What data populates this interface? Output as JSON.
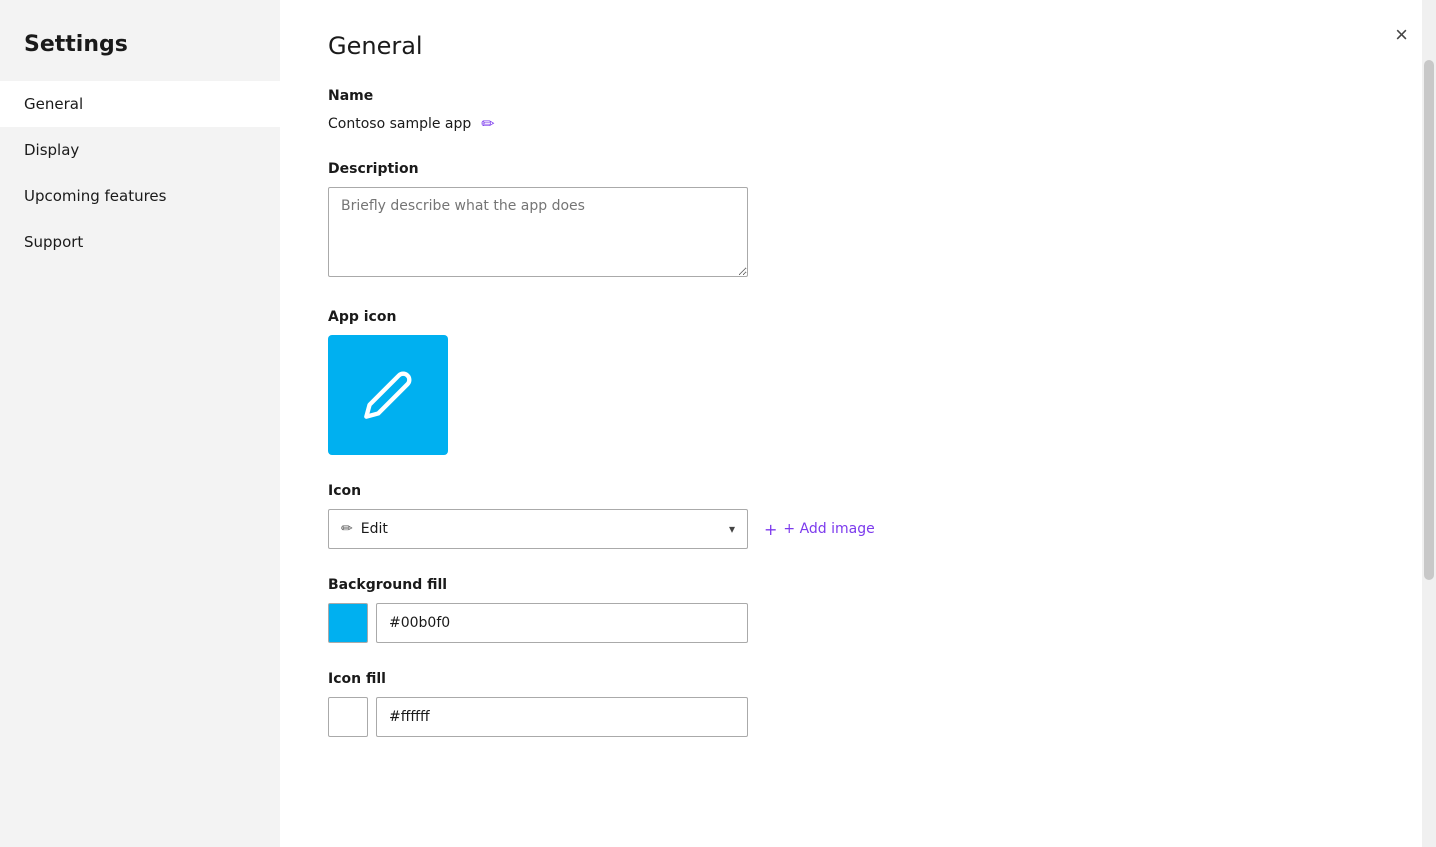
{
  "sidebar": {
    "title": "Settings",
    "items": [
      {
        "id": "general",
        "label": "General",
        "active": true
      },
      {
        "id": "display",
        "label": "Display",
        "active": false
      },
      {
        "id": "upcoming",
        "label": "Upcoming features",
        "active": false
      },
      {
        "id": "support",
        "label": "Support",
        "active": false
      }
    ]
  },
  "main": {
    "page_title": "General",
    "close_label": "×",
    "sections": {
      "name": {
        "label": "Name",
        "value": "Contoso sample app",
        "edit_icon": "✏"
      },
      "description": {
        "label": "Description",
        "placeholder": "Briefly describe what the app does"
      },
      "app_icon": {
        "label": "App icon"
      },
      "icon": {
        "label": "Icon",
        "dropdown_value": "Edit",
        "add_image_label": "+ Add image",
        "plus_label": "+"
      },
      "background_fill": {
        "label": "Background fill",
        "color": "#00b0f0",
        "value": "#00b0f0"
      },
      "icon_fill": {
        "label": "Icon fill",
        "color": "#ffffff",
        "value": "#ffffff"
      }
    }
  }
}
